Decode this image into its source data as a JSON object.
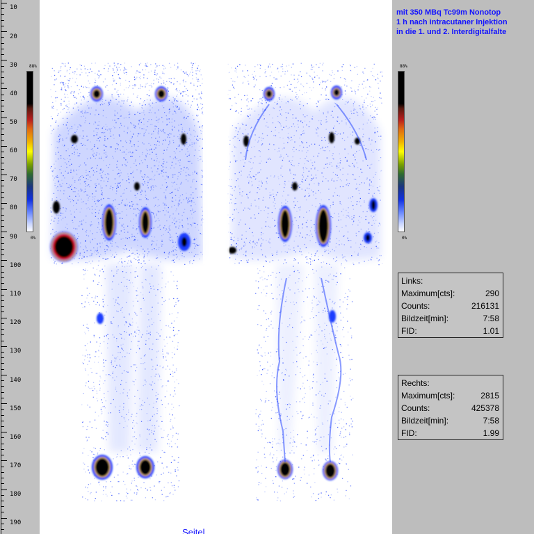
{
  "ruler": {
    "labels": [
      "10",
      "20",
      "30",
      "40",
      "50",
      "60",
      "70",
      "80",
      "90",
      "100",
      "110",
      "120",
      "130",
      "140",
      "150",
      "160",
      "170",
      "180",
      "190"
    ]
  },
  "caption": {
    "line1": "mit 350 MBq Tc99m Nonotop",
    "line2": "1 h nach intracutaner Injektion",
    "line3": "in die 1. und 2. Interdigitalfalte"
  },
  "colorbars": {
    "left_top": "88%",
    "left_bottom": "0%",
    "right_top": "88%",
    "right_bottom": "0%"
  },
  "links": {
    "title": "Links:",
    "rows": [
      {
        "label": "Maximum[cts]:",
        "value": "290"
      },
      {
        "label": "Counts:",
        "value": "216131"
      },
      {
        "label": "Bildzeit[min]:",
        "value": "7:58"
      },
      {
        "label": "FID:",
        "value": "1.01"
      }
    ]
  },
  "rechts": {
    "title": "Rechts:",
    "rows": [
      {
        "label": "Maximum[cts]:",
        "value": "2815"
      },
      {
        "label": "Counts:",
        "value": "425378"
      },
      {
        "label": "Bildzeit[min]:",
        "value": "7:58"
      },
      {
        "label": "FID:",
        "value": "1.99"
      }
    ]
  },
  "bottom_label": "Seitel",
  "colors": {
    "caption_blue": "#1414ff",
    "scan_blue": "#1a3cff"
  }
}
